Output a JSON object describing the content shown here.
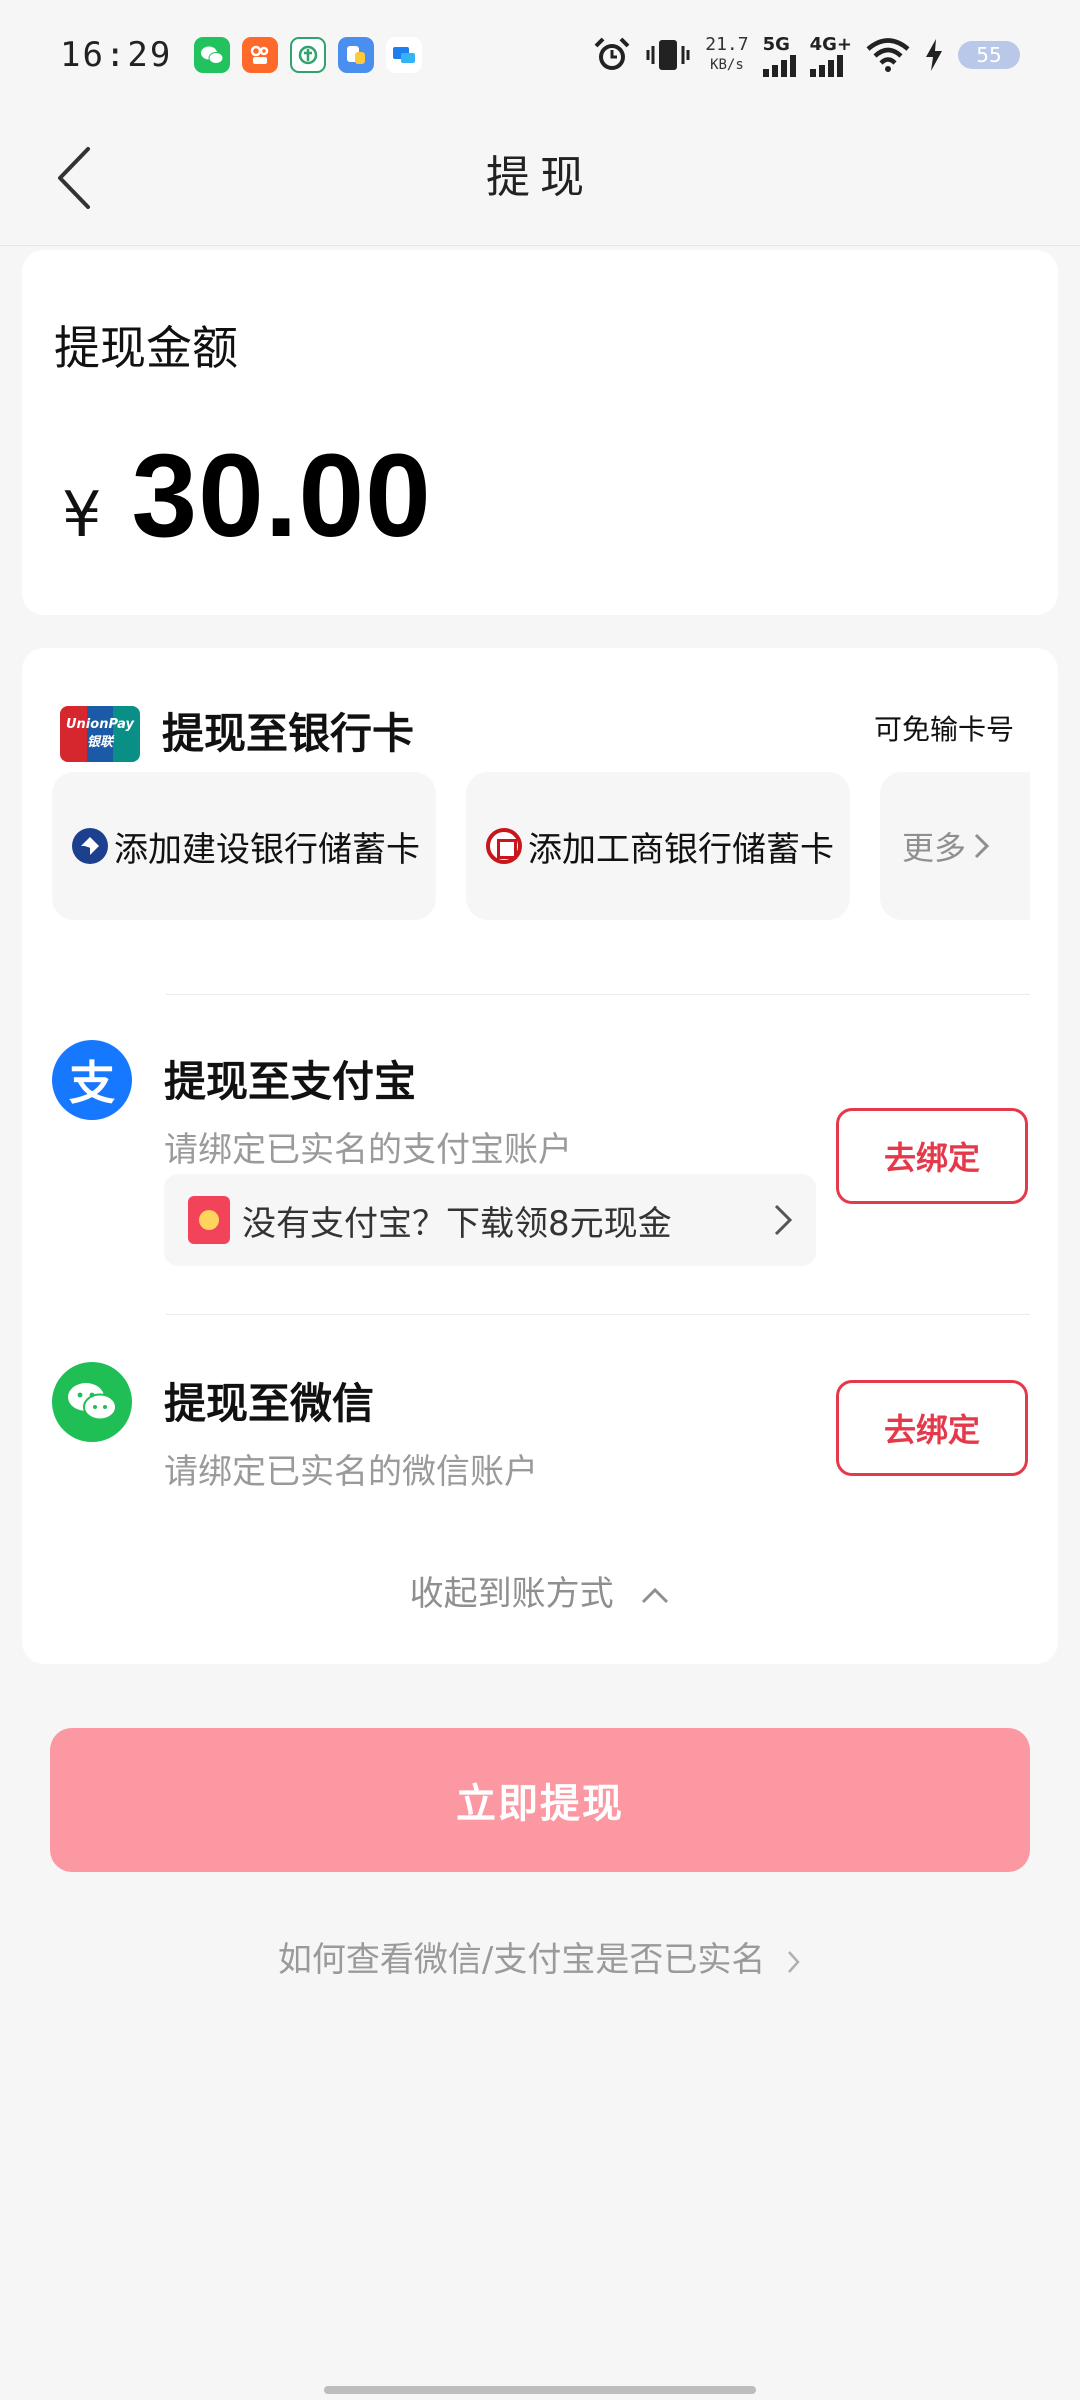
{
  "status_bar": {
    "time": "16:29",
    "net_speed_value": "21.7",
    "net_speed_unit": "KB/s",
    "network_5g": "5G",
    "network_4g": "4G+",
    "battery": "55"
  },
  "header": {
    "title": "提现"
  },
  "amount": {
    "label": "提现金额",
    "currency": "¥",
    "value": "30.00"
  },
  "bank": {
    "title": "提现至银行卡",
    "tip": "可免输卡号",
    "options": [
      {
        "label": "添加建设银行储蓄卡"
      },
      {
        "label": "添加工商银行储蓄卡"
      }
    ],
    "more": "更多"
  },
  "alipay": {
    "icon_char": "支",
    "title": "提现至支付宝",
    "subtitle": "请绑定已实名的支付宝账户",
    "bind_label": "去绑定",
    "promo": "没有支付宝？下载领8元现金"
  },
  "wechat": {
    "title": "提现至微信",
    "subtitle": "请绑定已实名的微信账户",
    "bind_label": "去绑定"
  },
  "collapse_label": "收起到账方式",
  "submit_label": "立即提现",
  "help_link": "如何查看微信/支付宝是否已实名",
  "colors": {
    "accent": "#e4394a",
    "submit_bg": "#fc98a2",
    "alipay_blue": "#1677ff",
    "wechat_green": "#1fbf55"
  }
}
